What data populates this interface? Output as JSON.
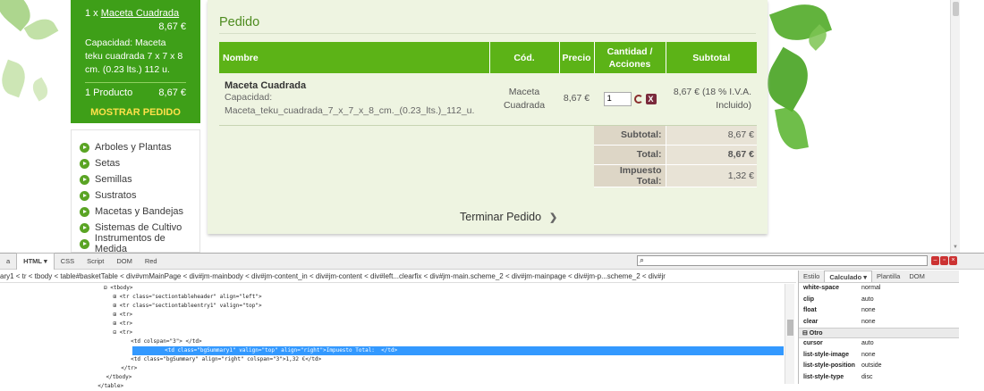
{
  "cart": {
    "qty": "1 x",
    "product_link": "Maceta Cuadrada",
    "price": "8,67 €",
    "description": "Capacidad: Maceta teku cuadrada 7 x 7 x 8 cm. (0.23 lts.) 112 u.",
    "count": "1 Producto",
    "total": "8,67 €",
    "show_order": "MOSTRAR PEDIDO"
  },
  "categories": [
    "Arboles y Plantas",
    "Setas",
    "Semillas",
    "Sustratos",
    "Macetas y Bandejas",
    "Sistemas de Cultivo",
    "Instrumentos de Medida"
  ],
  "order": {
    "title": "Pedido",
    "headers": {
      "name": "Nombre",
      "code": "Cód.",
      "price": "Precio",
      "qty": "Cantidad / Acciones",
      "subtotal": "Subtotal"
    },
    "item": {
      "name": "Maceta Cuadrada",
      "attr_label": "Capacidad:",
      "attr_value": "Maceta_teku_cuadrada_7_x_7_x_8_cm._(0.23_lts.)_112_u.",
      "code": "Maceta Cuadrada",
      "price": "8,67 €",
      "qty": "1",
      "subtotal": "8,67 € (18 % I.V.A. Incluido)"
    },
    "summary": [
      {
        "label": "Subtotal:",
        "value": "8,67 €"
      },
      {
        "label": "Total:",
        "value": "8,67 €"
      },
      {
        "label": "Impuesto Total:",
        "value": "1,32 €"
      }
    ],
    "finish": "Terminar Pedido"
  },
  "firebug": {
    "tabs": [
      "a",
      "HTML ▾",
      "CSS",
      "Script",
      "DOM",
      "Red"
    ],
    "breadcrumbs": "ary1 < tr < tbody < table#basketTable < div#vmMainPage < div#jm-mainbody < div#jm-content_in < div#jm-content < div#left...clearfix < div#jm-main.scheme_2 < div#jm-mainpage < div#jm-p...scheme_2 < div#jr",
    "side_tabs": [
      "Estilo",
      "Calculado ▾",
      "Plantilla",
      "DOM"
    ],
    "tree": [
      "⊟ <tbody>",
      "    ⊞ <tr class=\"sectiontableheader\" align=\"left\">",
      "    ⊞ <tr class=\"sectiontableentry1\" valign=\"top\">",
      "    ⊞ <tr>",
      "    ⊞ <tr>",
      "    ⊟ <tr>",
      "          <td colspan=\"3\"> </td>",
      "          <td class=\"bgSummary1\" valign=\"top\" align=\"right\">Impuesto Total:  </td>",
      "          <td class=\"bgSummary\" align=\"right\" colspan=\"3\">1,32 €</td>",
      "       </tr>",
      "    </tbody>",
      "  </table>"
    ],
    "props": [
      {
        "k": "white-space",
        "v": "normal"
      },
      {
        "k": "clip",
        "v": "auto"
      },
      {
        "k": "float",
        "v": "none"
      },
      {
        "k": "clear",
        "v": "none"
      }
    ],
    "group_other": "⊟ Otro",
    "props2": [
      {
        "k": "cursor",
        "v": "auto"
      },
      {
        "k": "list-style-image",
        "v": "none"
      },
      {
        "k": "list-style-position",
        "v": "outside"
      },
      {
        "k": "list-style-type",
        "v": "disc"
      }
    ]
  }
}
